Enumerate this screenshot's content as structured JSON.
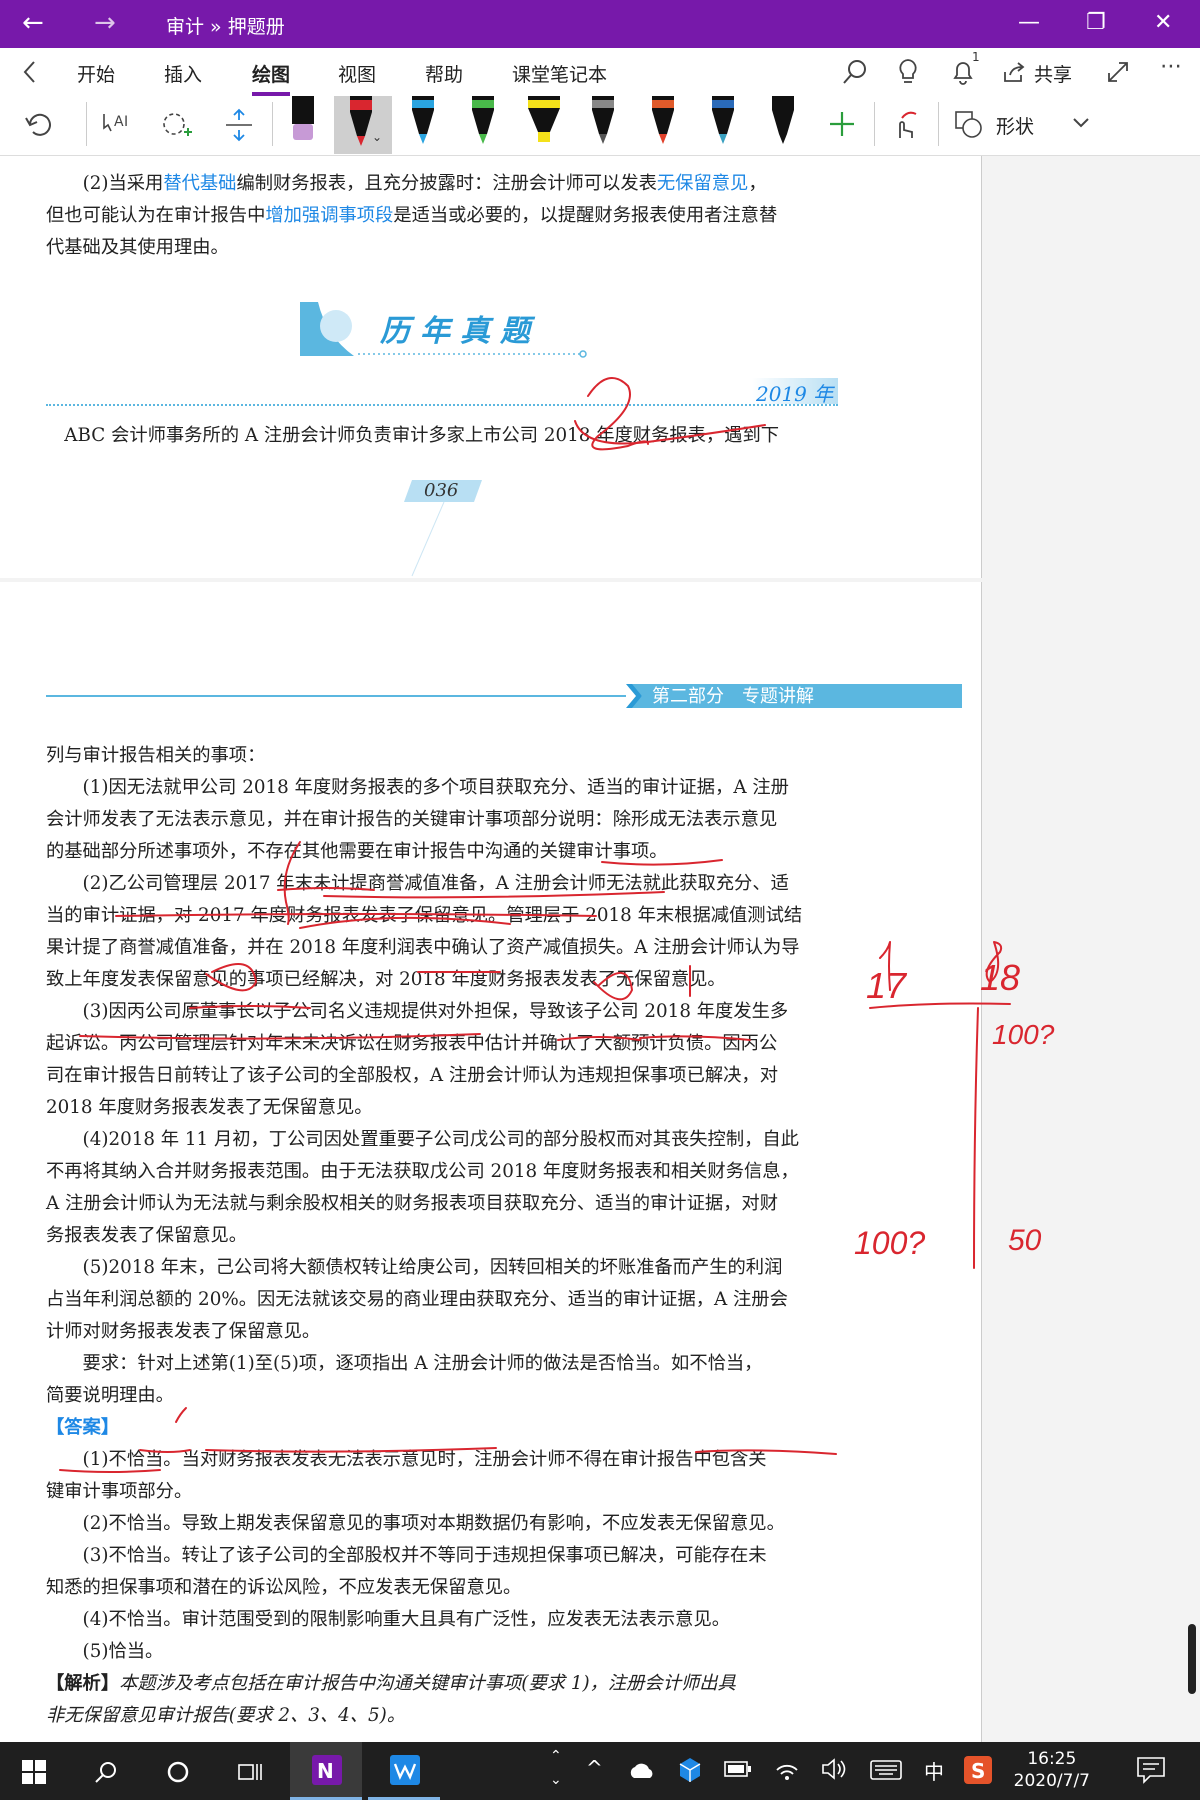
{
  "titlebar": {
    "title": "审计 » 押题册",
    "back": "←",
    "forward": "→",
    "minimize": "—",
    "restore": "❐",
    "close": "✕"
  },
  "tabs": [
    "开始",
    "插入",
    "绘图",
    "视图",
    "帮助",
    "课堂笔记本"
  ],
  "active_tab": "绘图",
  "ribbon_right": {
    "notification_count": "1",
    "share": "共享"
  },
  "toolbar": {
    "shape_label": "形状"
  },
  "colors": {
    "accent": "#7719aa",
    "link_blue": "#1e88e5",
    "ink_red": "#d9262f",
    "banner_blue": "#5bb7e0"
  },
  "page1": {
    "line1": "(2)当采用",
    "line1_b1": "替代基础",
    "line1_m1": "编制财务报表，且充分披露时：注册会计师可以发表",
    "line1_b2": "无保留意见",
    "line1_end": "，",
    "line2_a": "但也可能认为在审计报告中",
    "line2_b": "增加强调事项段",
    "line2_c": "是适当或必要的，以提醒财务报表使用者注意替",
    "line3": "代基础及其使用理由。",
    "heading": "历年真题",
    "year": "2019 年",
    "intro": "ABC 会计师事务所的 A 注册会计师负责审计多家上市公司 2018 年度财务报表，遇到下",
    "page_num": "036"
  },
  "page2": {
    "banner": "第二部分　专题讲解",
    "lines": [
      "列与审计报告相关的事项：",
      "　　(1)因无法就甲公司 2018 年度财务报表的多个项目获取充分、适当的审计证据，A 注册",
      "会计师发表了无法表示意见，并在审计报告的关键审计事项部分说明：除形成无法表示意见",
      "的基础部分所述事项外，不存在其他需要在审计报告中沟通的关键审计事项。",
      "　　(2)乙公司管理层 2017 年末未计提商誉减值准备，A 注册会计师无法就此获取充分、适",
      "当的审计证据，对 2017 年度财务报表发表了保留意见。管理层于 2018 年末根据减值测试结",
      "果计提了商誉减值准备，并在 2018 年度利润表中确认了资产减值损失。A 注册会计师认为导",
      "致上年度发表保留意见的事项已经解决，对 2018 年度财务报表发表了无保留意见。",
      "　　(3)因丙公司原董事长以子公司名义违规提供对外担保，导致该子公司 2018 年度发生多",
      "起诉讼。丙公司管理层针对年末未决诉讼在财务报表中估计并确认了大额预计负债。因丙公",
      "司在审计报告日前转让了该子公司的全部股权，A 注册会计师认为违规担保事项已解决，对",
      "2018 年度财务报表发表了无保留意见。",
      "　　(4)2018 年 11 月初，丁公司因处置重要子公司戊公司的部分股权而对其丧失控制，自此",
      "不再将其纳入合并财务报表范围。由于无法获取戊公司 2018 年度财务报表和相关财务信息，",
      "A 注册会计师认为无法就与剩余股权相关的财务报表项目获取充分、适当的审计证据，对财",
      "务报表发表了保留意见。",
      "　　(5)2018 年末，己公司将大额债权转让给庚公司，因转回相关的坏账准备而产生的利润",
      "占当年利润总额的 20%。因无法就该交易的商业理由获取充分、适当的审计证据，A 注册会",
      "计师对财务报表发表了保留意见。",
      "　　要求：针对上述第(1)至(5)项，逐项指出 A 注册会计师的做法是否恰当。如不恰当，",
      "简要说明理由。"
    ],
    "answer_label": "【答案】",
    "answers": [
      "　　(1)不恰当。当对财务报表发表无法表示意见时，注册会计师不得在审计报告中包含关",
      "键审计事项部分。",
      "　　(2)不恰当。导致上期发表保留意见的事项对本期数据仍有影响，不应发表无保留意见。",
      "　　(3)不恰当。转让了该子公司的全部股权并不等同于违规担保事项已解决，可能存在未",
      "知悉的担保事项和潜在的诉讼风险，不应发表无保留意见。",
      "　　(4)不恰当。审计范围受到的限制影响重大且具有广泛性，应发表无法表示意见。",
      "　　(5)恰当。"
    ],
    "analysis_label": "【解析】",
    "analysis_1": "本题涉及考点包括在审计报告中沟通关键审计事项(要求 1)，注册会计师出具",
    "analysis_2": "非无保留意见审计报告(要求 2、3、4、5)。"
  },
  "ink_notes": {
    "n17": "17",
    "n18": "18",
    "n100a": "100?",
    "n100b": "100?",
    "n50": "50"
  },
  "taskbar": {
    "time": "16:25",
    "date": "2020/7/7",
    "ime": "中"
  }
}
